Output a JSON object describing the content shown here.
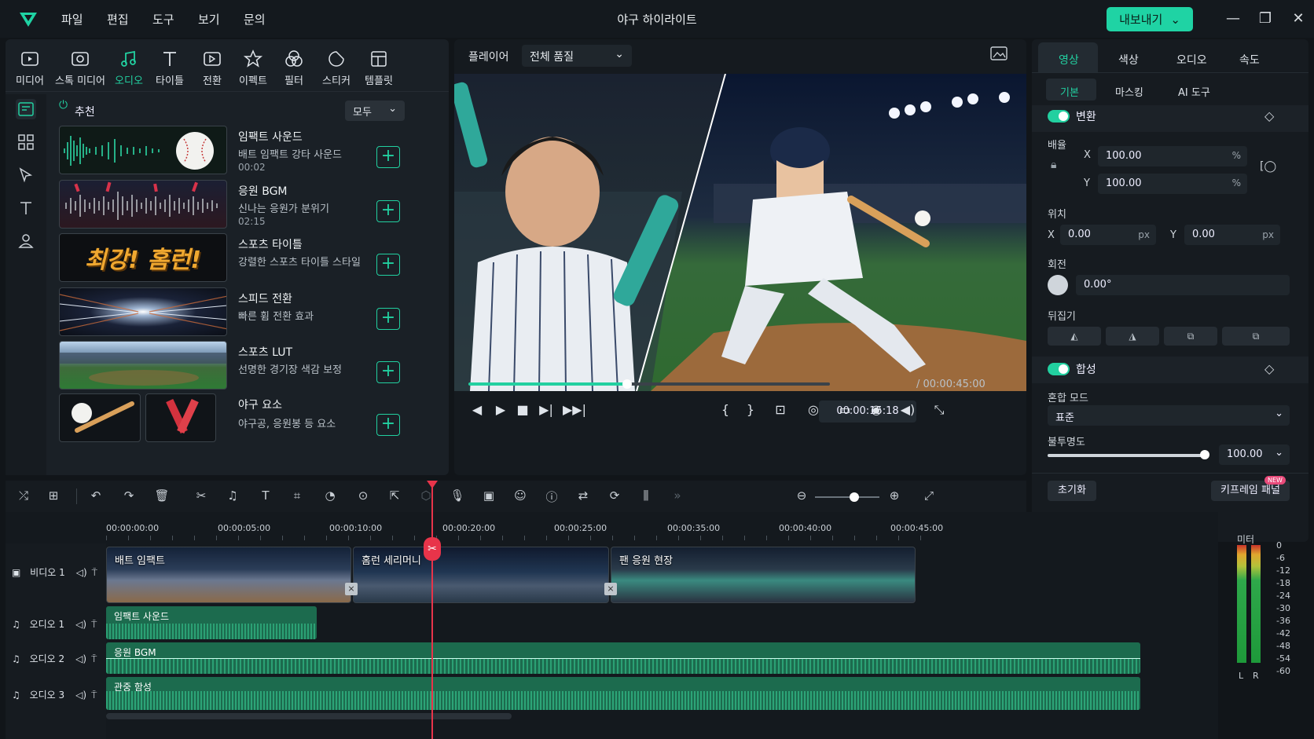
{
  "app": {
    "title": "야구 하이라이트",
    "export_label": "내보내기"
  },
  "menu": [
    "파일",
    "편집",
    "도구",
    "보기",
    "문의"
  ],
  "media_tabs": [
    "미디어",
    "스톡 미디어",
    "오디오",
    "타이틀",
    "전환",
    "이펙트",
    "필터",
    "스티커",
    "템플릿"
  ],
  "active_media_tab": "오디오",
  "library": {
    "section": "추천",
    "filter": "모두",
    "items": [
      {
        "title": "임팩트 사운드",
        "sub": "배트 임팩트 강타 사운드",
        "dur": "00:02"
      },
      {
        "title": "응원 BGM",
        "sub": "신나는 응원가 분위기",
        "dur": "02:15"
      },
      {
        "title": "스포츠 타이틀",
        "sub": "강렬한 스포츠 타이틀 스타일",
        "dur": "",
        "thumb_text": "최강! 홈런!"
      },
      {
        "title": "스피드 전환",
        "sub": "빠른 휨 전환 효과",
        "dur": ""
      },
      {
        "title": "스포츠 LUT",
        "sub": "선명한 경기장 색감 보정",
        "dur": ""
      },
      {
        "title": "야구 요소",
        "sub": "야구공, 응원봉 등 요소",
        "dur": ""
      }
    ]
  },
  "player": {
    "label": "플레이어",
    "quality": "전체 품질",
    "current": "00:00:15:18",
    "total": "/ 00:00:45:00",
    "progress": 0.44
  },
  "inspector": {
    "tabs": [
      "영상",
      "색상",
      "오디오",
      "속도"
    ],
    "subtabs": [
      "기본",
      "마스킹",
      "AI 도구"
    ],
    "transform": "변환",
    "scale": "배율",
    "scale_x": "100.00",
    "scale_y": "100.00",
    "position": "위치",
    "pos_x": "0.00",
    "pos_y": "0.00",
    "rotation": "회전",
    "rotation_val": "0.00°",
    "flip": "뒤집기",
    "composite": "합성",
    "blend_mode": "혼합 모드",
    "blend_val": "표준",
    "opacity": "불투명도",
    "opacity_val": "100.00",
    "reset": "초기화",
    "keyframe": "키프레임 패널",
    "new_badge": "NEW",
    "x": "X",
    "y": "Y",
    "pct": "%",
    "px": "px"
  },
  "timeline": {
    "ruler": [
      "00:00:00:00",
      "00:00:05:00",
      "00:00:10:00",
      "00:00:20:00",
      "00:00:25:00",
      "00:00:35:00",
      "00:00:40:00",
      "00:00:45:00"
    ],
    "tracks": [
      {
        "label": "비디오 1"
      },
      {
        "label": "오디오 1"
      },
      {
        "label": "오디오 2"
      },
      {
        "label": "오디오 3"
      }
    ],
    "video_clips": [
      "배트 임팩트",
      "홈런 세리머니",
      "팬 응원 현장"
    ],
    "audio_clips": [
      "임팩트 사운드",
      "응원 BGM",
      "관중 함성"
    ]
  },
  "meter": {
    "title": "미터",
    "scale": [
      "0",
      "-6",
      "-12",
      "-18",
      "-24",
      "-30",
      "-36",
      "-42",
      "-48",
      "-54",
      "-60"
    ],
    "left": "L",
    "right": "R"
  },
  "colors": {
    "accent": "#22d0a0",
    "playhead": "#e8344a",
    "panel": "#1a2026"
  }
}
